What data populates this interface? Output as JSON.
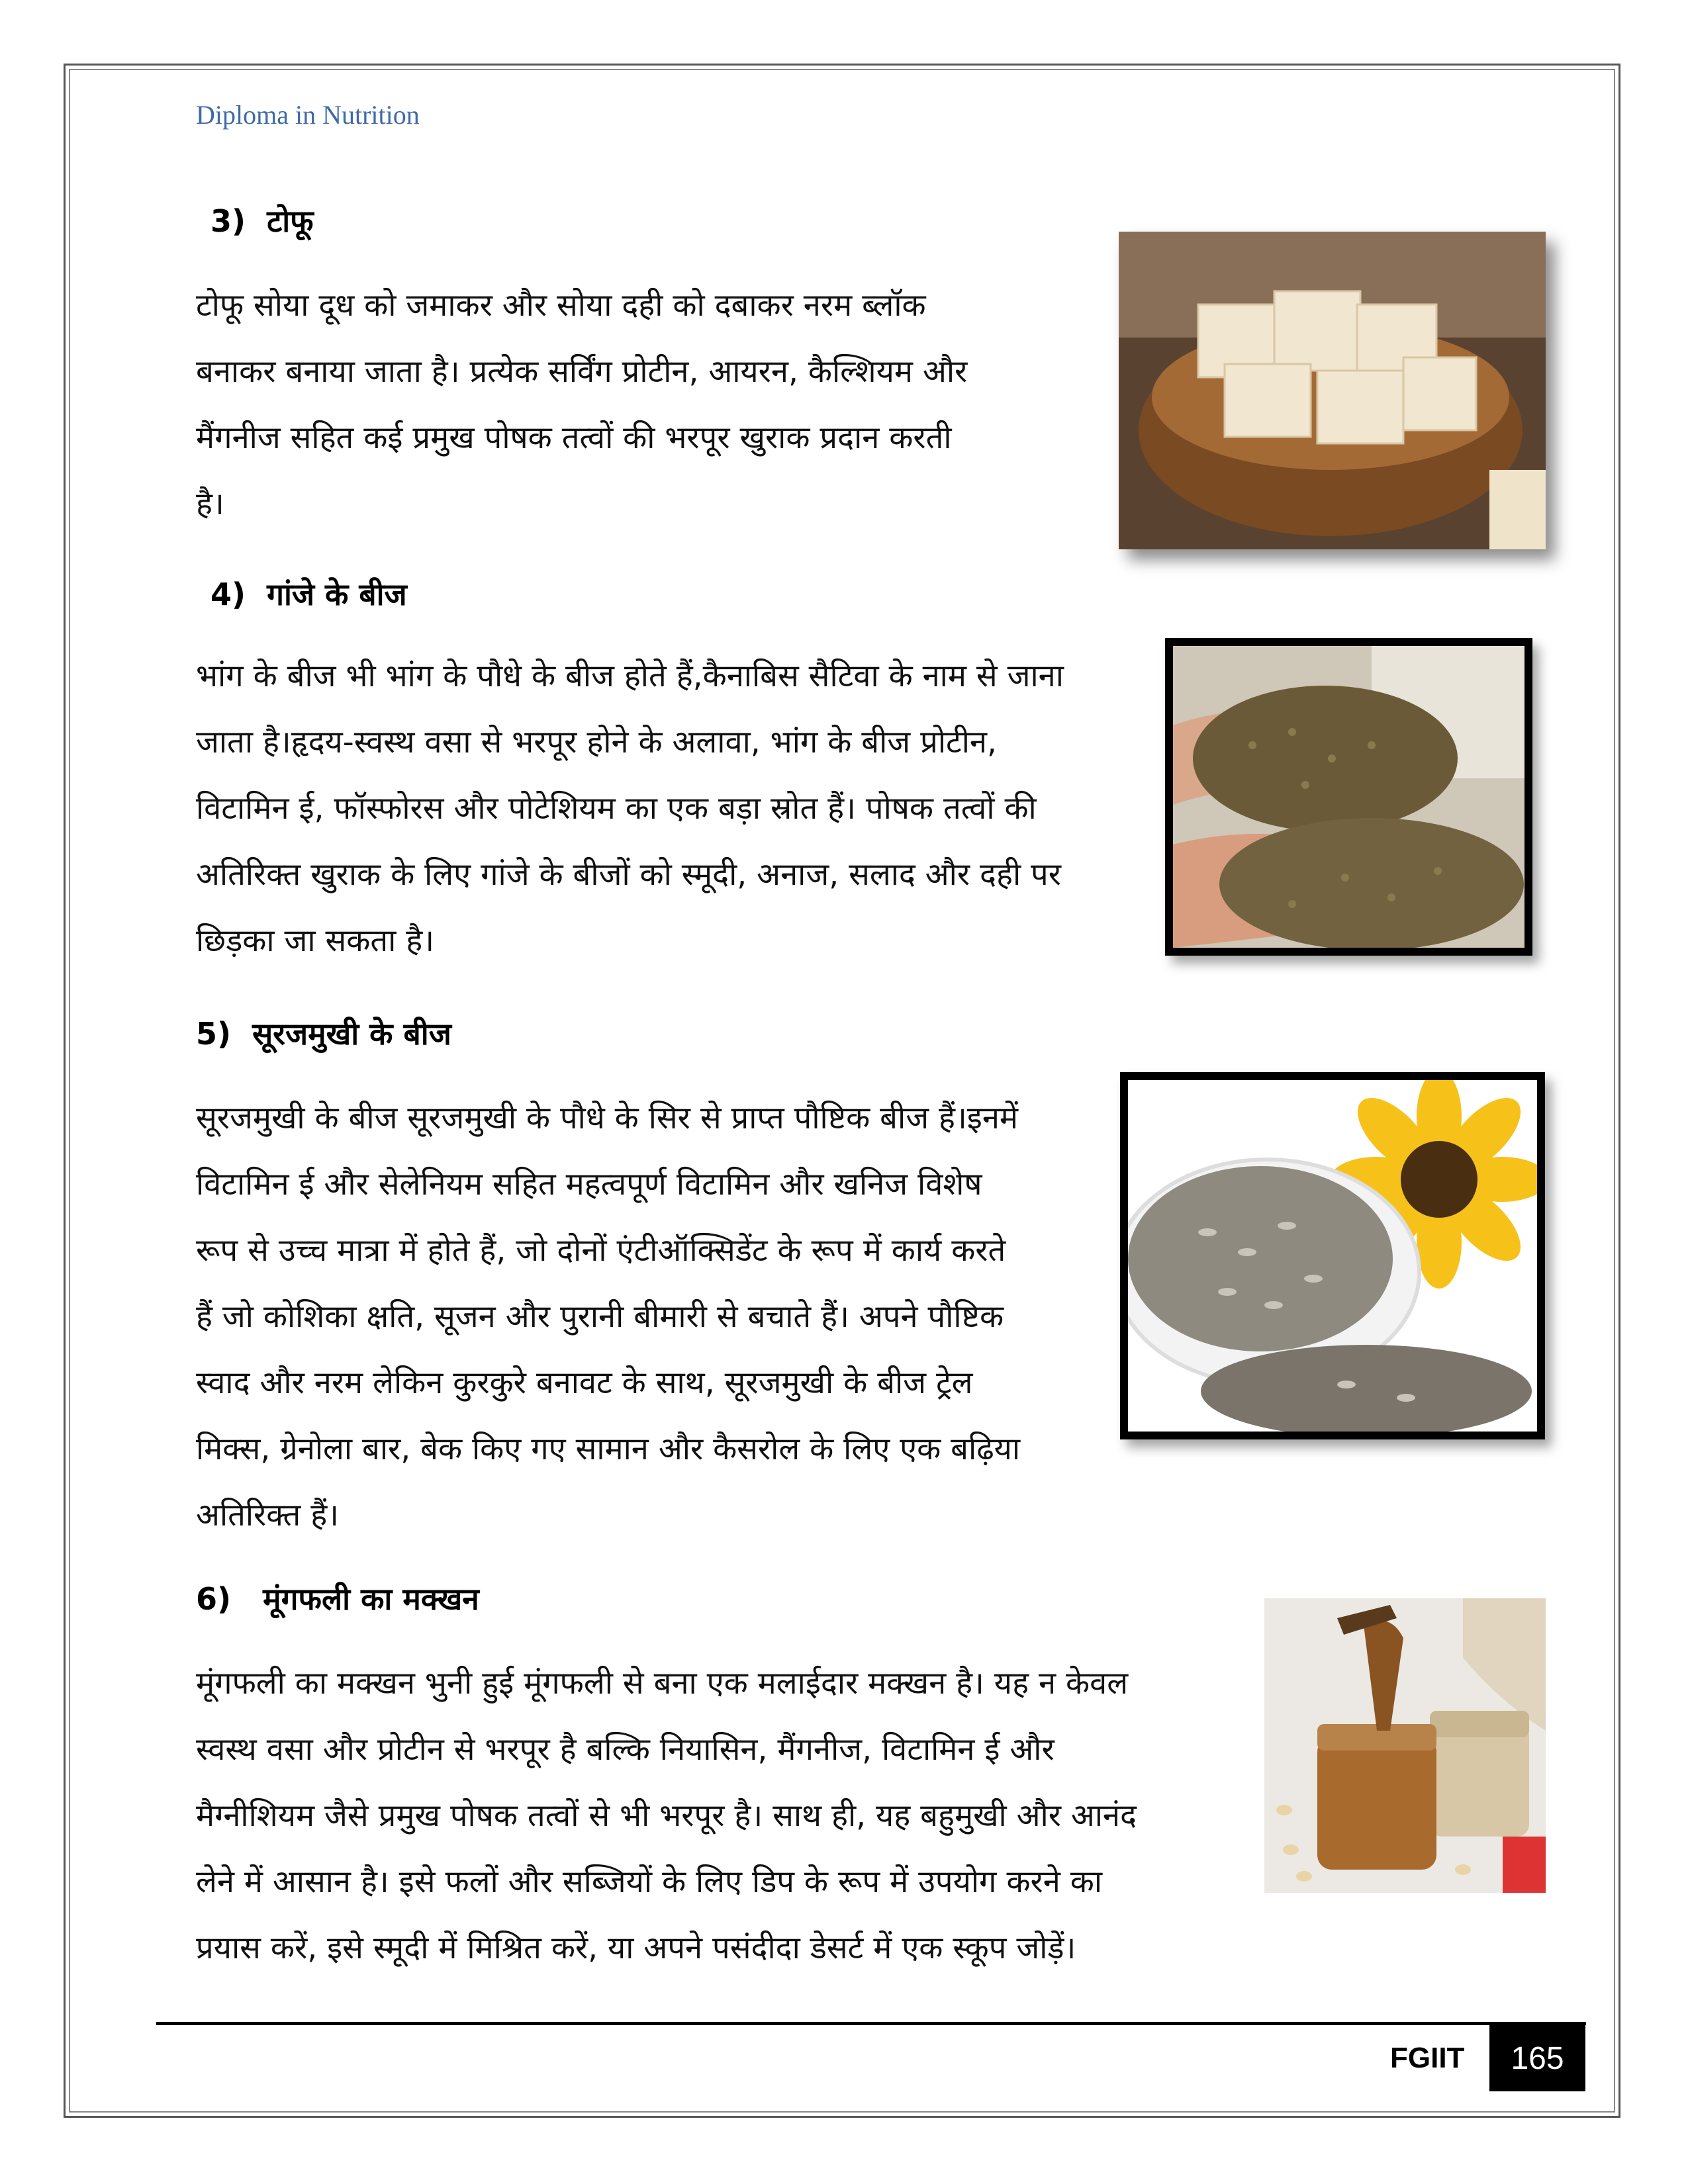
{
  "running_head": "Diploma in Nutrition",
  "sections": [
    {
      "number": "3)",
      "title": "टोफू",
      "lines": [
        "टोफू सोया दूध को जमाकर और सोया दही को दबाकर नरम ब्लॉक",
        "बनाकर बनाया जाता है। प्रत्येक सर्विंग प्रोटीन, आयरन, कैल्शियम और",
        "मैंगनीज सहित कई प्रमुख पोषक तत्वों की भरपूर खुराक प्रदान करती",
        "है।"
      ]
    },
    {
      "number": "4)",
      "title": "गांजे के बीज",
      "lines": [
        "भांग के बीज भी भांग के पौधे के बीज होते हैं,कैनाबिस सैटिवा के नाम से जाना",
        "जाता है।हृदय-स्वस्थ वसा से भरपूर होने के अलावा, भांग के बीज प्रोटीन,",
        "विटामिन ई, फॉस्फोरस और पोटेशियम का एक बड़ा स्रोत हैं। पोषक तत्वों की",
        "अतिरिक्त खुराक के लिए गांजे के बीजों को स्मूदी, अनाज, सलाद और दही पर",
        "छिड़का जा सकता है।"
      ]
    },
    {
      "number": "5)",
      "title": "सूरजमुखी के बीज",
      "lines": [
        "सूरजमुखी के बीज सूरजमुखी के पौधे के सिर से प्राप्त पौष्टिक बीज हैं।इनमें",
        "विटामिन ई और सेलेनियम सहित महत्वपूर्ण विटामिन और खनिज विशेष",
        "रूप से उच्च मात्रा में होते हैं, जो दोनों एंटीऑक्सिडेंट के रूप में कार्य करते",
        "हैं जो कोशिका क्षति, सूजन और पुरानी बीमारी से बचाते हैं। अपने पौष्टिक",
        "स्वाद और नरम लेकिन कुरकुरे बनावट के साथ, सूरजमुखी के बीज ट्रेल",
        "मिक्स, ग्रेनोला बार, बेक किए गए सामान और कैसरोल के लिए एक बढ़िया",
        "अतिरिक्त हैं।"
      ]
    },
    {
      "number": "6)",
      "title": "मूंगफली का मक्खन",
      "lines": [
        "मूंगफली का मक्खन भुनी हुई मूंगफली से बना एक मलाईदार मक्खन है। यह न केवल",
        "स्वस्थ वसा और प्रोटीन से भरपूर है बल्कि नियासिन, मैंगनीज, विटामिन ई और",
        "मैग्नीशियम जैसे प्रमुख पोषक तत्वों से भी भरपूर है। साथ ही, यह बहुमुखी और आनंद",
        "लेने में आसान है। इसे फलों और सब्जियों के लिए डिप के रूप में उपयोग करने का",
        "प्रयास करें, इसे स्मूदी में मिश्रित करें, या अपने पसंदीदा डेसर्ट में एक स्कूप जोड़ें।"
      ]
    }
  ],
  "footer": {
    "label": "FGIIT",
    "page_number": "165"
  }
}
